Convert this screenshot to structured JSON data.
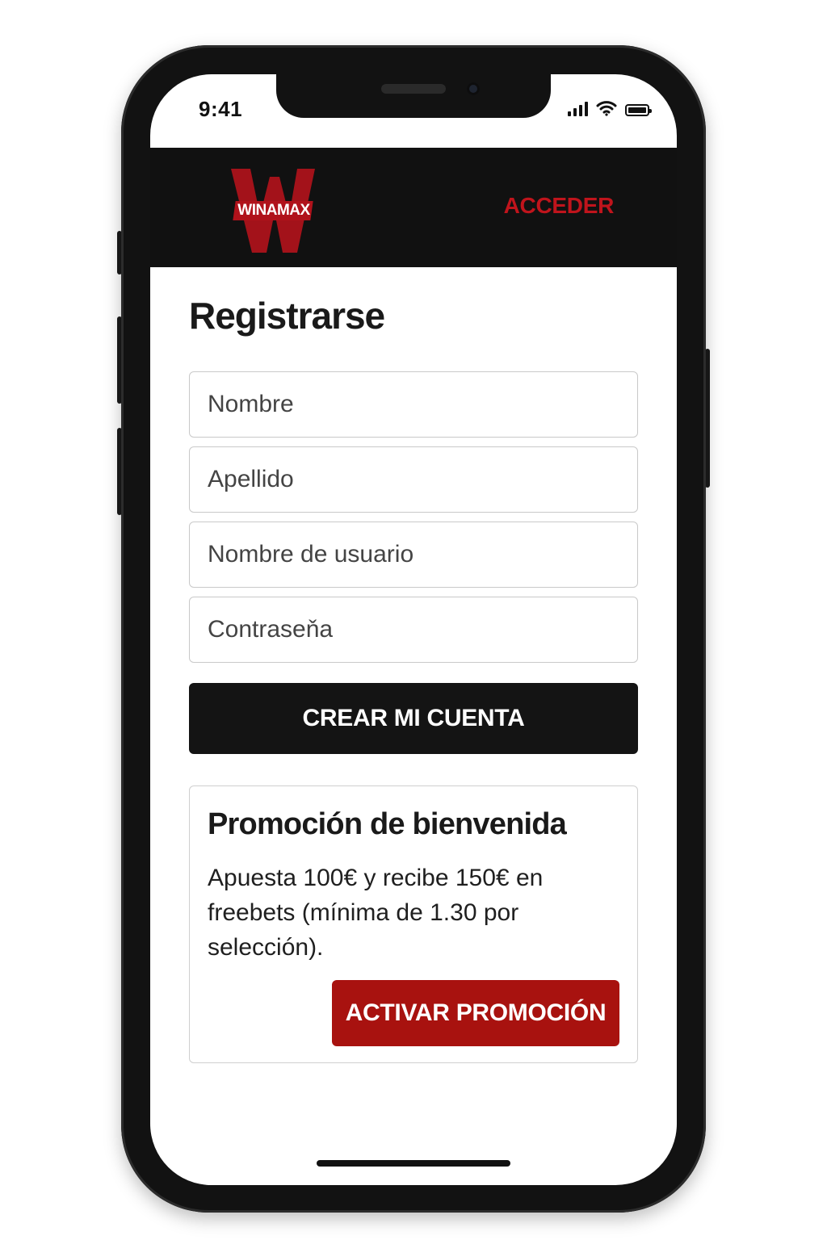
{
  "status_bar": {
    "time": "9:41"
  },
  "header": {
    "logo_text": "WINAMAX",
    "login_label": "ACCEDER"
  },
  "form": {
    "title": "Registrarse",
    "fields": {
      "first_name_placeholder": "Nombre",
      "last_name_placeholder": "Apellido",
      "username_placeholder": "Nombre de usuario",
      "password_placeholder": "Contraseňa"
    },
    "submit_label": "CREAR MI CUENTA"
  },
  "promo": {
    "title": "Promoción de bienvenida",
    "description": "Apuesta 100€ y recibe 150€ en freebets (mínima de 1.30 por selección).",
    "button_label": "ACTIVAR PROMOCIÓN"
  },
  "colors": {
    "header_bg": "#111111",
    "brand_red": "#c0141c",
    "promo_button": "#a8120f",
    "primary_button": "#141414"
  },
  "icons": [
    "signal-icon",
    "wifi-icon",
    "battery-icon",
    "winamax-logo"
  ]
}
